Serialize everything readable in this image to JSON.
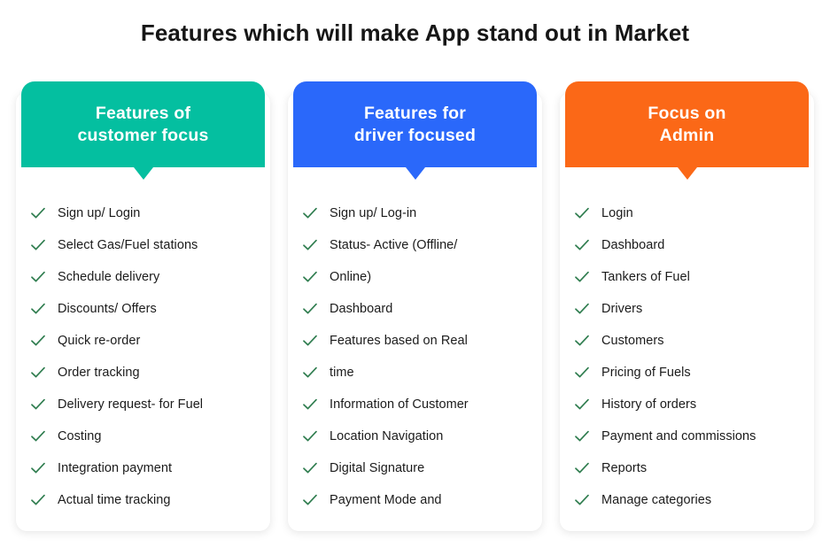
{
  "title": "Features which will make App stand out in Market",
  "colors": {
    "teal": "#04bfa0",
    "blue": "#2a68fa",
    "orange": "#fb6817",
    "check_green": "#2f7d4f",
    "title_color": "#161616",
    "text_color": "#1b1b1b",
    "card_background": "#ffffff",
    "page_background": "#ffffff"
  },
  "icons": {
    "check": "check-icon"
  },
  "columns": [
    {
      "id": "customer",
      "header": "Features of\ncustomer focus",
      "accent": "#04bfa0",
      "items": [
        "Sign up/ Login",
        "Select Gas/Fuel stations",
        "Schedule delivery",
        "Discounts/ Offers",
        "Quick re-order",
        "Order tracking",
        "Delivery request- for Fuel",
        "Costing",
        "Integration payment",
        "Actual time tracking"
      ]
    },
    {
      "id": "driver",
      "header": "Features for\ndriver focused",
      "accent": "#2a68fa",
      "items": [
        "Sign up/ Log-in",
        "Status- Active (Offline/",
        "Online)",
        "Dashboard",
        "Features based on Real",
        "time",
        "Information of Customer",
        "Location Navigation",
        "Digital Signature",
        "Payment Mode and"
      ]
    },
    {
      "id": "admin",
      "header": "Focus on\nAdmin",
      "accent": "#fb6817",
      "items": [
        "Login",
        "Dashboard",
        "Tankers of Fuel",
        "Drivers",
        "Customers",
        "Pricing of Fuels",
        "History of orders",
        "Payment and commissions",
        "Reports",
        "Manage categories"
      ]
    }
  ]
}
